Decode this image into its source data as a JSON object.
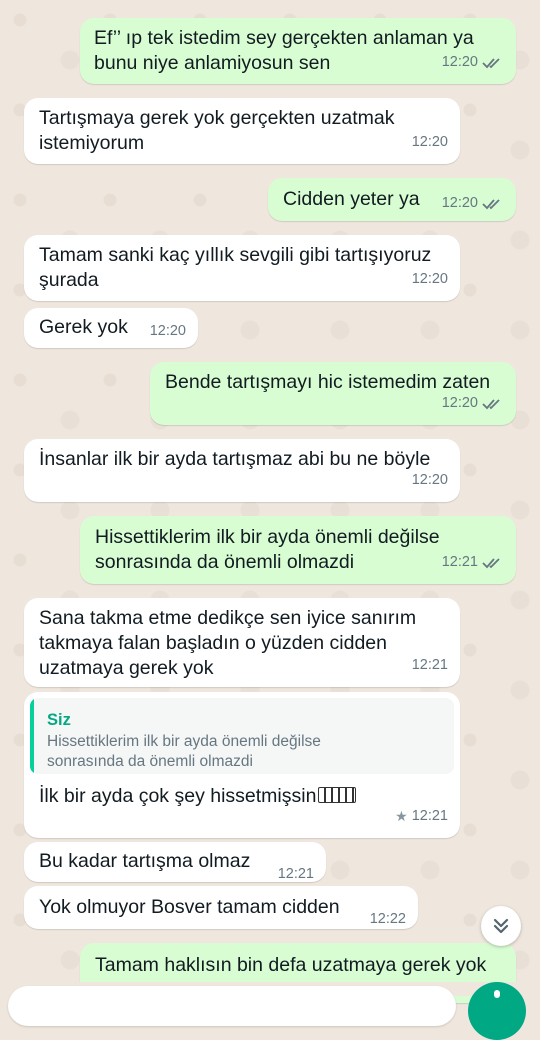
{
  "messages": [
    {
      "dir": "out",
      "text": "Ef’’ ıp tek istedim sey gerçekten anlaman ya\nbunu niye anlamiyosun sen",
      "time": "12:20"
    },
    {
      "dir": "in",
      "text": "Tartışmaya gerek yok gerçekten uzatmak\nistemiyorum",
      "time": "12:20"
    },
    {
      "dir": "out",
      "text": "Cidden yeter ya",
      "time": "12:20"
    },
    {
      "dir": "in",
      "text": "Tamam sanki kaç yıllık sevgili gibi tartışıyoruz\nşurada",
      "time": "12:20"
    },
    {
      "dir": "in",
      "text": "Gerek yok",
      "time": "12:20"
    },
    {
      "dir": "out",
      "text": "Bende tartışmayı hic istemedim zaten",
      "time": "12:20"
    },
    {
      "dir": "in",
      "text": "İnsanlar ilk bir ayda tartışmaz abi bu ne böyle",
      "time": "12:20"
    },
    {
      "dir": "out",
      "text": "Hissettiklerim ilk bir ayda önemli değilse\nsonrasında da önemli olmazdi",
      "time": "12:21"
    },
    {
      "dir": "in",
      "text": "Sana takma etme dedikçe sen iyice sanırım\ntakmaya falan başladın o yüzden cidden\nuzatmaya gerek yok",
      "time": "12:21"
    },
    {
      "dir": "in",
      "text": "İlk bir ayda çok şey hissetmişsin",
      "time": "12:21",
      "quote": {
        "author": "Siz",
        "text": "Hissettiklerim ilk bir ayda önemli değilse\nsonrasında da önemli olmazdi"
      },
      "starred": true,
      "emoji": "emoji-sticker-icon"
    },
    {
      "dir": "in",
      "text": "Bu kadar tartışma olmaz",
      "time": "12:21"
    },
    {
      "dir": "in",
      "text": "Yok olmuyor Bosver tamam cidden",
      "time": "12:22"
    },
    {
      "dir": "out",
      "text": "Tamam haklısın bin defa uzatmaya gerek yok",
      "time": ""
    }
  ],
  "icons": {
    "read_receipt": "double-check-icon",
    "scroll": "double-chevron-down-icon",
    "star": "star-icon",
    "mic": "mic-icon"
  },
  "colors": {
    "outgoing": "#d9fdd3",
    "incoming": "#ffffff",
    "read_ticks": "#53bdeb",
    "accent": "#00a884",
    "background": "#efe7de"
  }
}
